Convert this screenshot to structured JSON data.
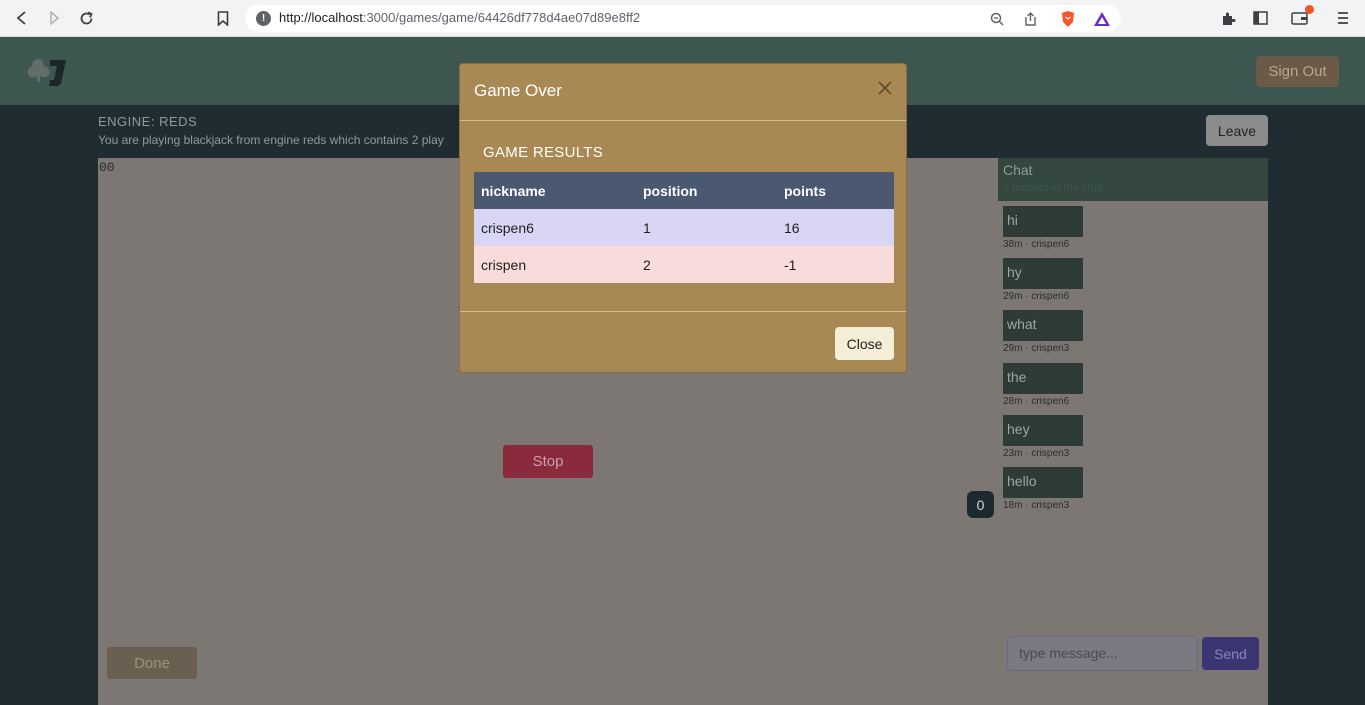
{
  "browser": {
    "url_host": "http://localhost",
    "url_path": ":3000/games/game/64426df778d4ae07d89e8ff2"
  },
  "header": {
    "sign_out_label": "Sign Out"
  },
  "game": {
    "engine_title": "ENGINE: REDS",
    "engine_description": "You are playing blackjack from engine reds which contains 2 play",
    "timer": "00",
    "leave_label": "Leave",
    "stop_label": "Stop",
    "done_label": "Done",
    "count_badge": "0"
  },
  "chat": {
    "title": "Chat",
    "subtitle": "2 gamers in the chat.",
    "messages": [
      {
        "text": "hi",
        "meta": "38m · crispen6"
      },
      {
        "text": "hy",
        "meta": "29m · crispen6"
      },
      {
        "text": "what",
        "meta": "29m · crispen3"
      },
      {
        "text": "the",
        "meta": "28m · crispen6"
      },
      {
        "text": "hey",
        "meta": "23m · crispen3"
      },
      {
        "text": "hello",
        "meta": "18m · crispen3"
      }
    ],
    "input_placeholder": "type message...",
    "send_label": "Send"
  },
  "modal": {
    "title": "Game Over",
    "section_title": "GAME RESULTS",
    "columns": [
      "nickname",
      "position",
      "points"
    ],
    "rows": [
      [
        "crispen6",
        "1",
        "16"
      ],
      [
        "crispen",
        "2",
        "-1"
      ]
    ],
    "close_label": "Close"
  },
  "colors": {
    "modal_bg": "#a88954",
    "table_header": "#4a5870",
    "row_first": "#d9d5f5",
    "row_second": "#f8dcdc",
    "send_button": "#3b3574"
  }
}
